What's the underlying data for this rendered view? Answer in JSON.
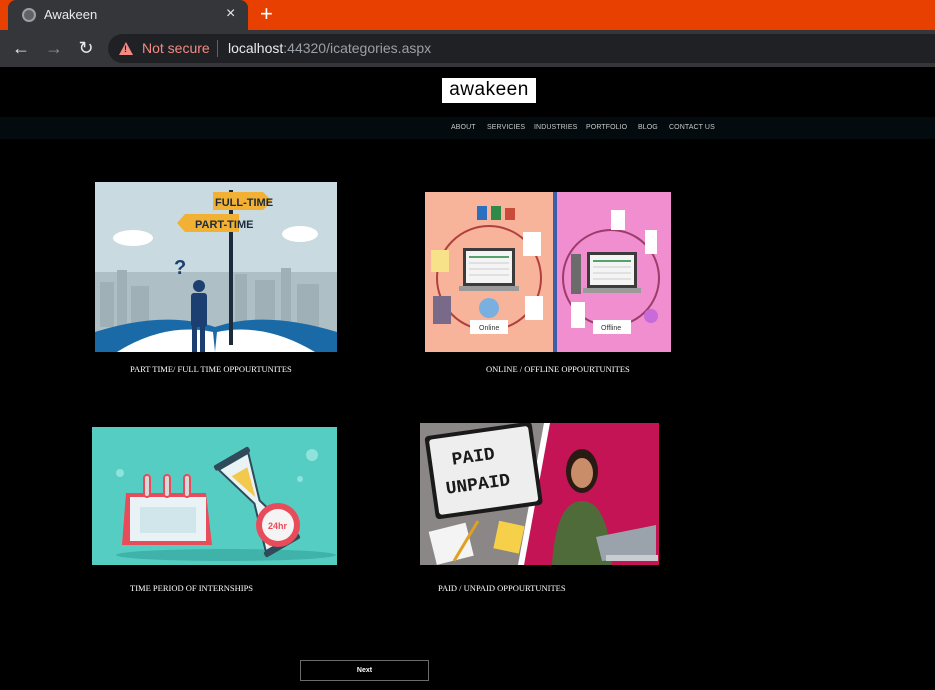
{
  "browser": {
    "tab_title": "Awakeen",
    "tab_close": "×",
    "new_tab": "+",
    "back": "←",
    "forward": "→",
    "reload": "↻",
    "security_label": "Not secure",
    "url_host": "localhost",
    "url_rest": ":44320/icategories.aspx"
  },
  "site": {
    "logo": "awakeen",
    "nav": [
      "ABOUT",
      "SERVICIES",
      "INDUSTRIES",
      "PORTFOLIO",
      "BLOG",
      "CONTACT US"
    ]
  },
  "categories": [
    {
      "label": "PART TIME/ FULL TIME OPPOURTUNITES",
      "image_signs": [
        "FULL-TIME",
        "PART-TIME"
      ]
    },
    {
      "label": "ONLINE / OFFLINE OPPOURTUNITES",
      "image_signs": [
        "Online",
        "Offline"
      ]
    },
    {
      "label": "TIME PERIOD OF INTERNSHIPS",
      "image_signs": [
        "24hr"
      ]
    },
    {
      "label": "PAID / UNPAID OPPOURTUNITES",
      "image_signs": [
        "PAID",
        "UNPAID"
      ]
    }
  ],
  "next_label": "Next",
  "colors": {
    "tabbar": "#e84000",
    "chrome": "#35363a",
    "page_bg": "#000000",
    "navbar": "#040b0e"
  }
}
